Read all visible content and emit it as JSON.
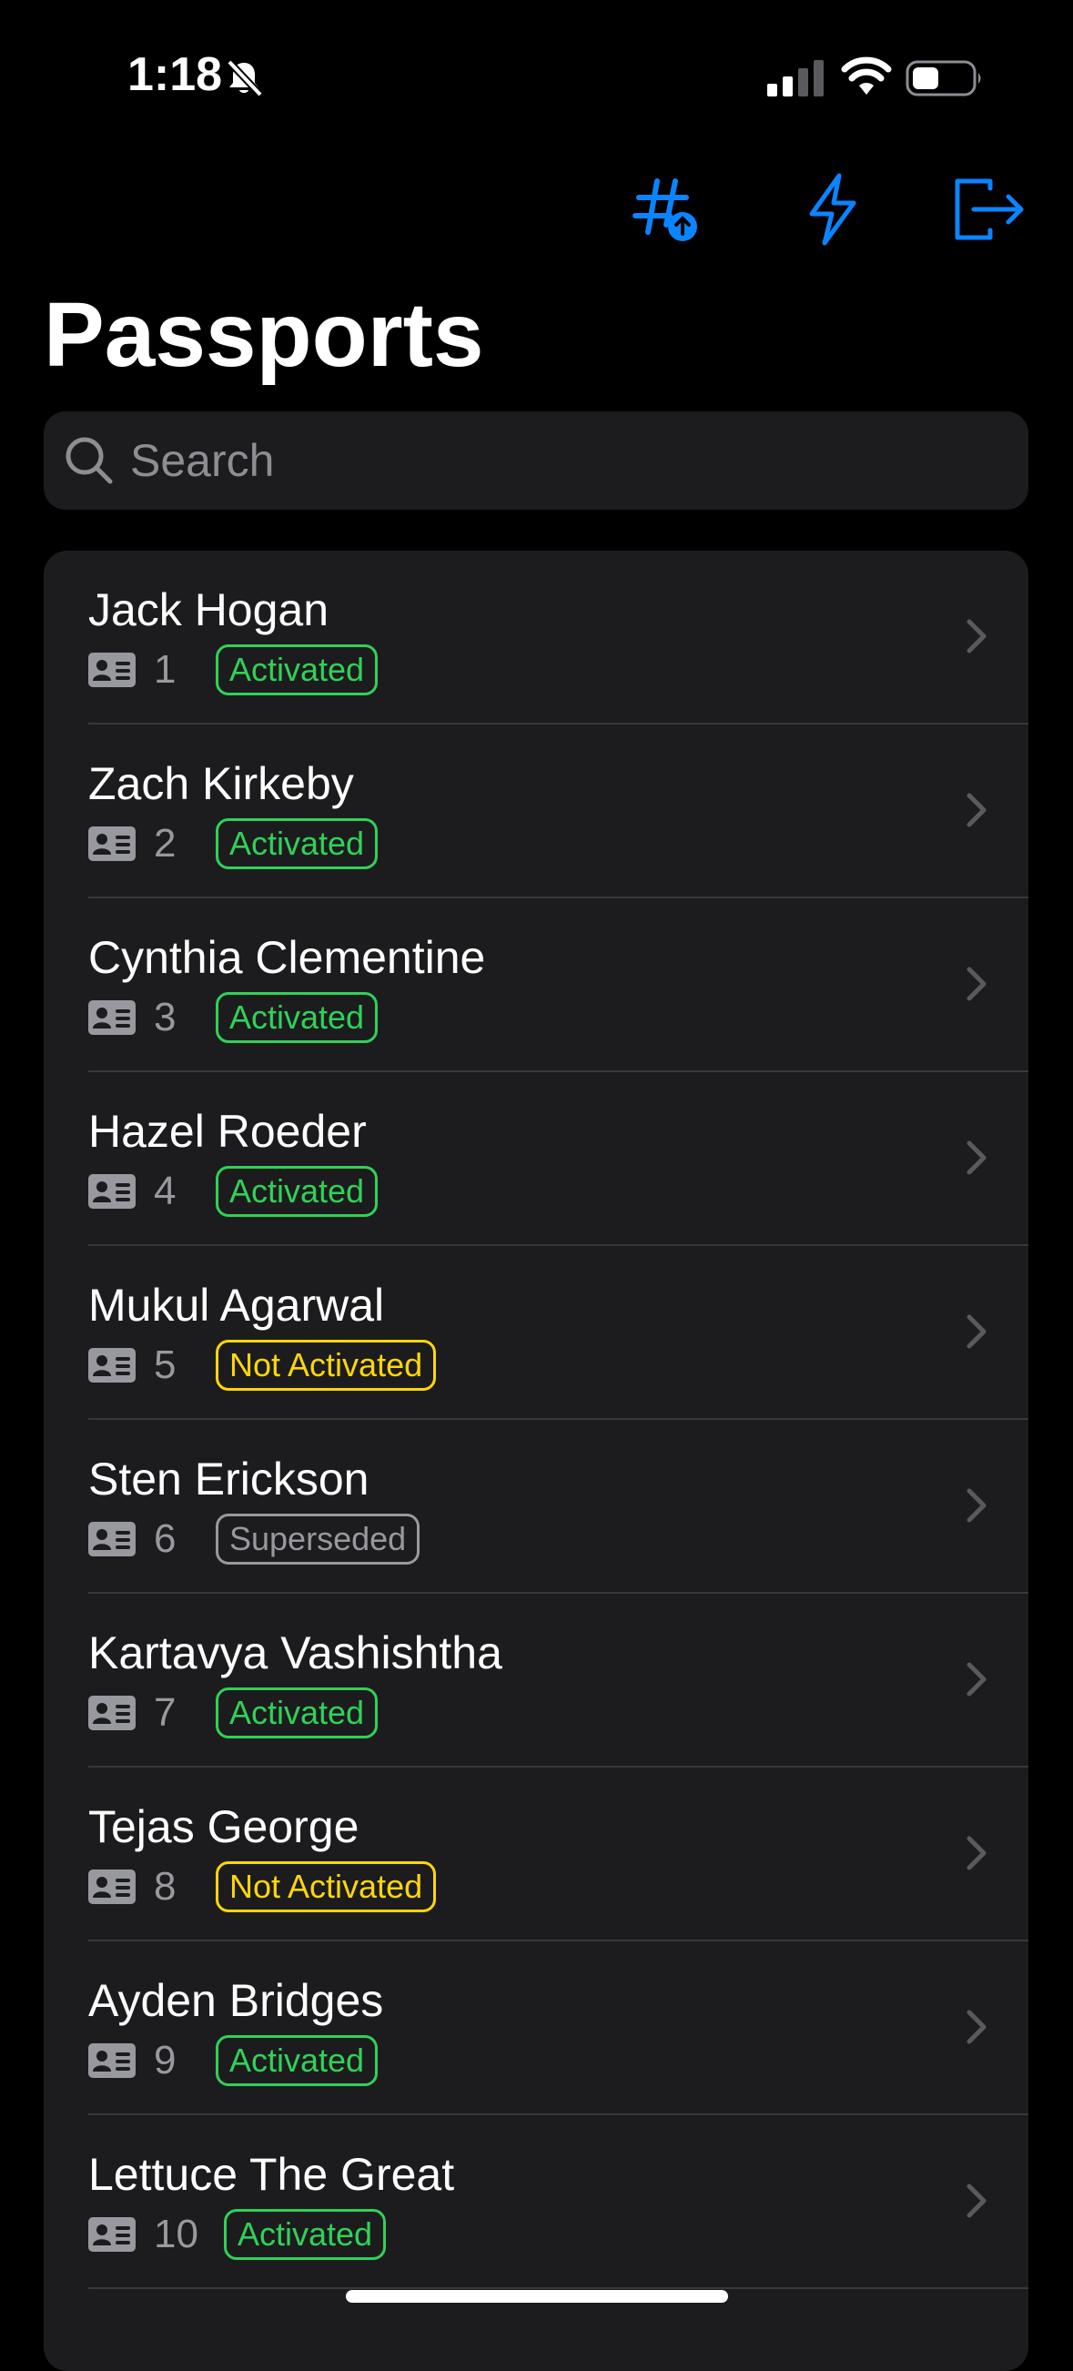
{
  "status_bar": {
    "time": "1:18",
    "bell_icon": "bell-slash-icon",
    "signal_icon": "cellular-signal-icon",
    "wifi_icon": "wifi-icon",
    "battery_icon": "battery-icon"
  },
  "toolbar": {
    "hashtag_button_icon": "hashtag-upload-icon",
    "bolt_button_icon": "lightning-bolt-icon",
    "logout_button_icon": "logout-icon",
    "accent_color": "#0a84ff"
  },
  "page": {
    "title": "Passports"
  },
  "search": {
    "placeholder": "Search",
    "value": ""
  },
  "colors": {
    "activated": "#30d158",
    "not_activated": "#ffd60a",
    "superseded": "#98989f",
    "row_background": "#1c1c1e",
    "separator": "#38383a"
  },
  "passports": [
    {
      "name": "Jack Hogan",
      "number": "1",
      "status": "Activated"
    },
    {
      "name": "Zach Kirkeby",
      "number": "2",
      "status": "Activated"
    },
    {
      "name": "Cynthia Clementine",
      "number": "3",
      "status": "Activated"
    },
    {
      "name": "Hazel Roeder",
      "number": "4",
      "status": "Activated"
    },
    {
      "name": "Mukul Agarwal",
      "number": "5",
      "status": "Not Activated"
    },
    {
      "name": "Sten Erickson",
      "number": "6",
      "status": "Superseded"
    },
    {
      "name": "Kartavya Vashishtha",
      "number": "7",
      "status": "Activated"
    },
    {
      "name": "Tejas George",
      "number": "8",
      "status": "Not Activated"
    },
    {
      "name": "Ayden Bridges",
      "number": "9",
      "status": "Activated"
    },
    {
      "name": "Lettuce The Great",
      "number": "10",
      "status": "Activated"
    }
  ]
}
